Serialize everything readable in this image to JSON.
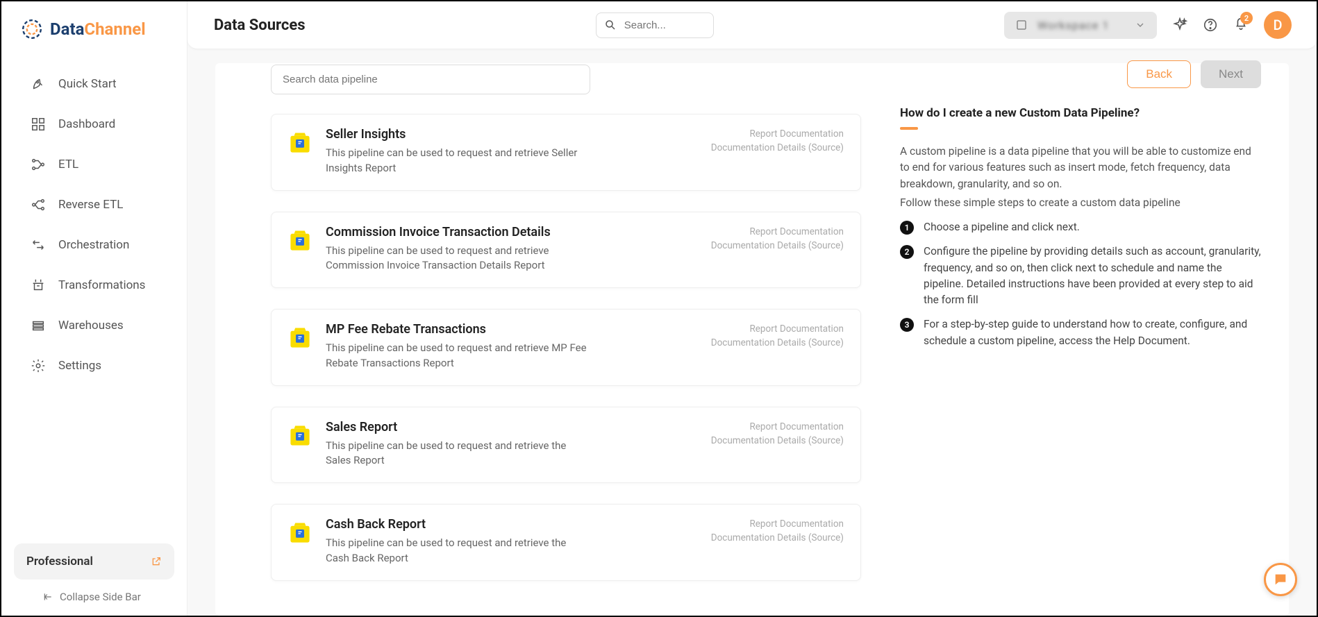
{
  "brand": {
    "name_part1": "Data",
    "name_part2": "Channel"
  },
  "header": {
    "title": "Data Sources",
    "search_placeholder": "Search...",
    "workspace_label": "Workspace 1",
    "notification_count": "2",
    "avatar_initial": "D"
  },
  "sidebar": {
    "items": [
      {
        "label": "Quick Start"
      },
      {
        "label": "Dashboard"
      },
      {
        "label": "ETL"
      },
      {
        "label": "Reverse ETL"
      },
      {
        "label": "Orchestration"
      },
      {
        "label": "Transformations"
      },
      {
        "label": "Warehouses"
      },
      {
        "label": "Settings"
      }
    ],
    "plan_label": "Professional",
    "collapse_label": "Collapse Side Bar"
  },
  "pipeline_search_placeholder": "Search data pipeline",
  "buttons": {
    "back": "Back",
    "next": "Next"
  },
  "pipe_links": {
    "doc": "Report Documentation",
    "details": "Documentation Details (Source)"
  },
  "pipelines": [
    {
      "title": "Seller Insights",
      "desc": "This pipeline can be used to request and retrieve Seller Insights Report"
    },
    {
      "title": "Commission Invoice Transaction Details",
      "desc": "This pipeline can be used to request and retrieve Commission Invoice Transaction Details Report"
    },
    {
      "title": "MP Fee Rebate Transactions",
      "desc": "This pipeline can be used to request and retrieve MP Fee Rebate Transactions Report"
    },
    {
      "title": "Sales Report",
      "desc": "This pipeline can be used to request and retrieve the Sales Report"
    },
    {
      "title": "Cash Back Report",
      "desc": "This pipeline can be used to request and retrieve the Cash Back Report"
    }
  ],
  "help": {
    "title": "How do I create a new Custom Data Pipeline?",
    "intro1": "A custom pipeline is a data pipeline that you will be able to customize end to end for various features such as insert mode, fetch frequency, data breakdown, granularity, and so on.",
    "intro2": "Follow these simple steps to create a custom data pipeline",
    "steps": [
      "Choose a pipeline and click next.",
      "Configure the pipeline by providing details such as account, granularity, frequency, and so on, then click next to schedule and name the pipeline. Detailed instructions have been provided at every step to aid the form fill",
      "For a step-by-step guide to understand how to create, configure, and schedule a custom pipeline, access the Help Document."
    ]
  },
  "colors": {
    "accent": "#f99746",
    "brand_blue": "#1c3f6e"
  }
}
